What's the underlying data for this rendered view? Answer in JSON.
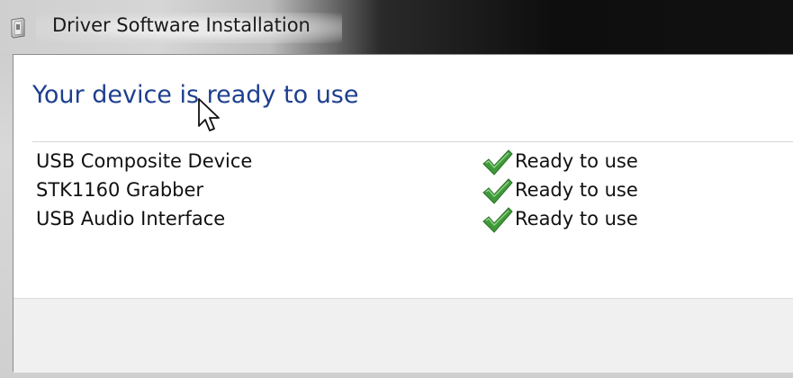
{
  "window": {
    "title": "Driver Software Installation",
    "icon": "driver-install-icon"
  },
  "main": {
    "heading": "Your device is ready to use",
    "devices": [
      {
        "name": "USB Composite Device",
        "status": "Ready to use",
        "status_icon": "green-checkmark-icon"
      },
      {
        "name": "STK1160 Grabber",
        "status": "Ready to use",
        "status_icon": "green-checkmark-icon"
      },
      {
        "name": "USB Audio Interface",
        "status": "Ready to use",
        "status_icon": "green-checkmark-icon"
      }
    ]
  },
  "colors": {
    "heading": "#1e3f8f",
    "checkmark": "#3f9a3a",
    "footer": "#f0f0f0"
  },
  "cursor": "arrow-cursor-icon"
}
